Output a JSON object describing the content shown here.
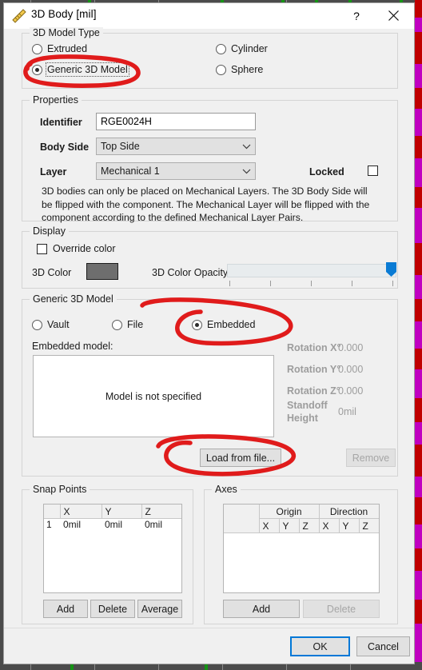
{
  "window": {
    "title": "3D Body [mil]",
    "icon": "ruler-triangle-icon",
    "help_label": "?",
    "close_label": "×"
  },
  "model_type": {
    "group_title": "3D Model Type",
    "options": [
      {
        "label": "Extruded",
        "selected": false
      },
      {
        "label": "Generic 3D Model",
        "selected": true
      },
      {
        "label": "Cylinder",
        "selected": false
      },
      {
        "label": "Sphere",
        "selected": false
      }
    ]
  },
  "properties": {
    "group_title": "Properties",
    "identifier_label": "Identifier",
    "identifier_value": "RGE0024H",
    "body_side_label": "Body Side",
    "body_side_value": "Top Side",
    "layer_label": "Layer",
    "layer_value": "Mechanical 1",
    "locked_label": "Locked",
    "locked_checked": false,
    "note": "3D bodies can only be placed on Mechanical Layers. The 3D Body Side will be flipped with the component. The Mechanical Layer will be flipped with the component according to the defined Mechanical Layer Pairs."
  },
  "display": {
    "group_title": "Display",
    "override_color_label": "Override color",
    "override_color_checked": false,
    "color_label": "3D Color",
    "color_value": "#6e6e6e",
    "opacity_label": "3D Color Opacity",
    "opacity_percent": 100,
    "accent_color": "#0a7bd4"
  },
  "generic_model": {
    "group_title": "Generic 3D Model",
    "sources": [
      {
        "label": "Vault",
        "selected": false
      },
      {
        "label": "File",
        "selected": false
      },
      {
        "label": "Embedded",
        "selected": true
      }
    ],
    "embedded_model_label": "Embedded model:",
    "panel_text": "Model is not specified",
    "rotation_x_label": "Rotation X°",
    "rotation_x_value": "0.000",
    "rotation_y_label": "Rotation Y°",
    "rotation_y_value": "0.000",
    "rotation_z_label": "Rotation Z°",
    "rotation_z_value": "0.000",
    "standoff_label_1": "Standoff",
    "standoff_label_2": "Height",
    "standoff_value": "0mil",
    "load_button": "Load from file...",
    "remove_button": "Remove"
  },
  "snap_points": {
    "group_title": "Snap Points",
    "columns": [
      "",
      "X",
      "Y",
      "Z"
    ],
    "rows": [
      {
        "no": "1",
        "x": "0mil",
        "y": "0mil",
        "z": "0mil"
      }
    ],
    "add_button": "Add",
    "delete_button": "Delete",
    "average_button": "Average"
  },
  "axes": {
    "group_title": "Axes",
    "group_headers": [
      "",
      "Origin",
      "Direction"
    ],
    "sub_headers": [
      "",
      "X",
      "Y",
      "Z",
      "X",
      "Y",
      "Z"
    ],
    "rows": [],
    "add_button": "Add",
    "delete_button": "Delete"
  },
  "footer": {
    "ok_label": "OK",
    "cancel_label": "Cancel"
  },
  "annotations": {
    "color": "#e01b1b",
    "marks": [
      "circle-generic-3d-model",
      "circle-embedded",
      "circle-load-from-file"
    ]
  }
}
